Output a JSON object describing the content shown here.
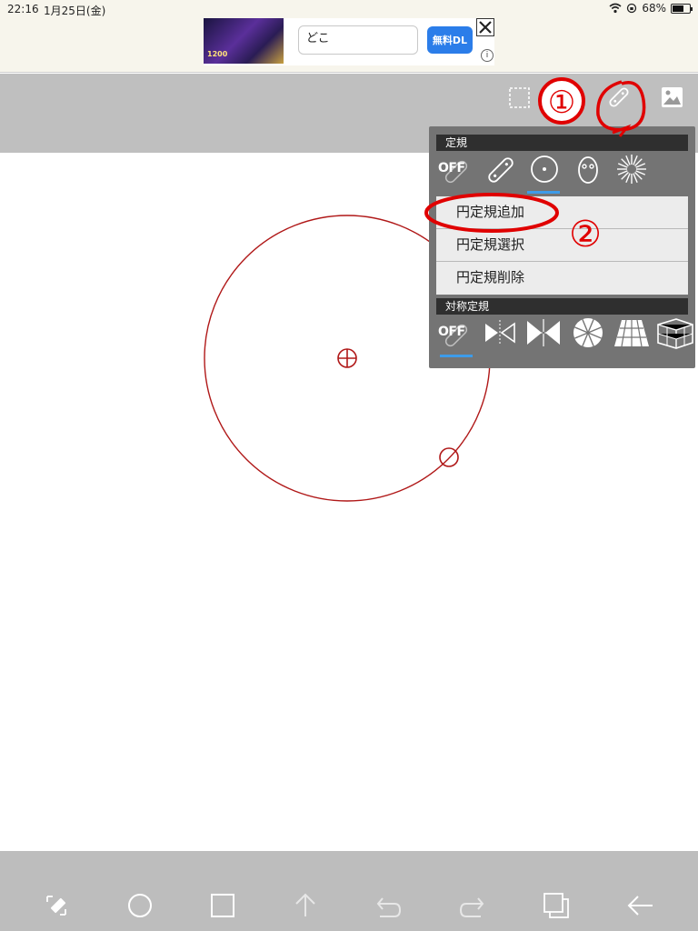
{
  "status_bar": {
    "time": "22:16",
    "date": "1月25日(金)",
    "battery_text": "68%",
    "battery_level": 0.68
  },
  "ad": {
    "thumb_text": "1200",
    "search_value": "どこ",
    "download_label": "無料DL",
    "info_label": "i"
  },
  "toolbar": {
    "icons": [
      "selection-icon",
      "ruler-icon",
      "image-icon"
    ]
  },
  "ruler_panel": {
    "ruler_header": "定規",
    "ruler_off_label": "OFF",
    "ruler_selected": "circle-ruler",
    "menu": [
      {
        "label": "円定規追加"
      },
      {
        "label": "円定規選択"
      },
      {
        "label": "円定規削除"
      }
    ],
    "symmetry_header": "対称定規",
    "symmetry_off_label": "OFF",
    "symmetry_selected": "off"
  },
  "annotations": {
    "marker1": "①",
    "marker2": "②",
    "color": "#e00000"
  },
  "canvas": {
    "circle_color": "#b01818"
  },
  "bottom_bar": {
    "icons": [
      "transform-icon",
      "circle-brush-icon",
      "square-layer-icon",
      "upload-icon",
      "undo-icon",
      "redo-icon",
      "layers-icon",
      "back-icon"
    ]
  }
}
